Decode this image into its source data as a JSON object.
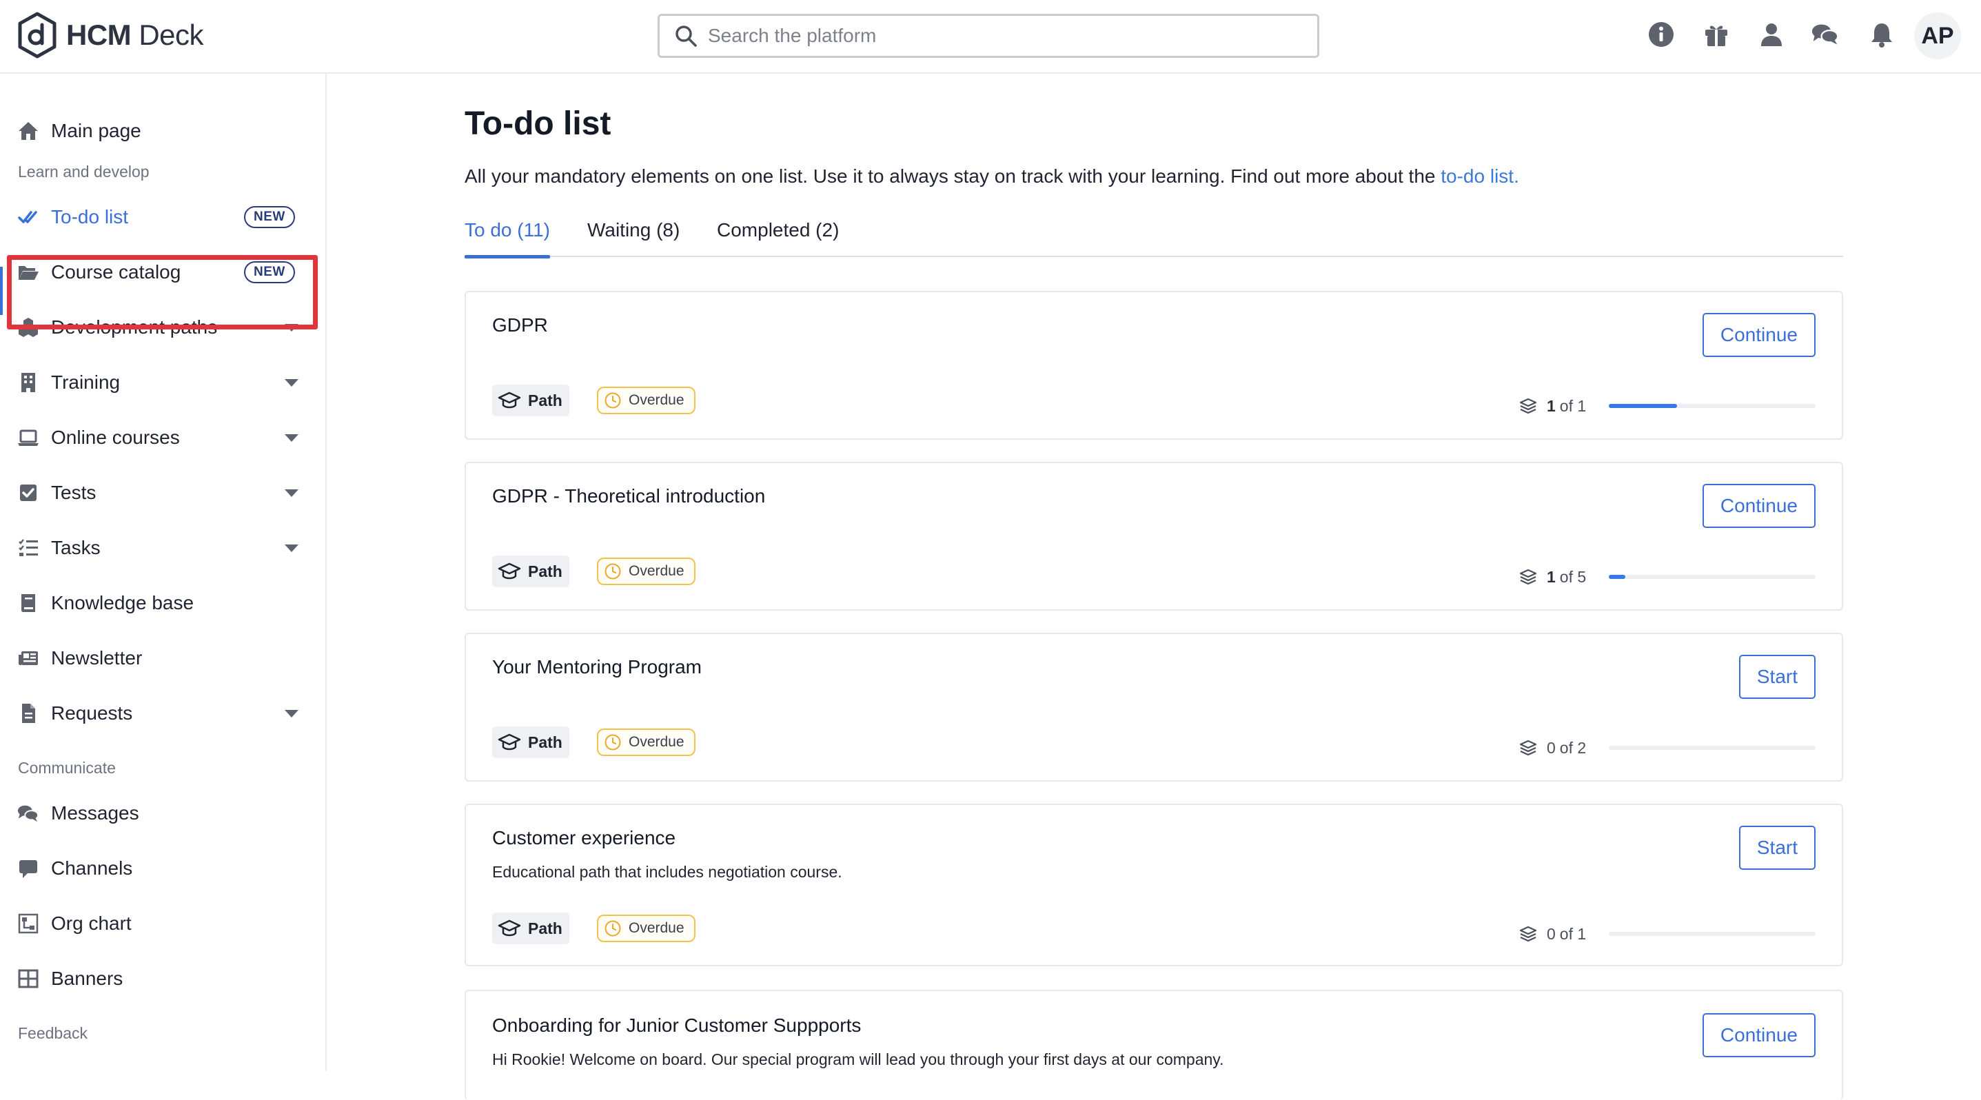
{
  "app": {
    "brand_bold": "HCM",
    "brand_light": "Deck",
    "search_placeholder": "Search the platform",
    "avatar_initials": "AP",
    "header_icons": [
      "info-icon",
      "gift-icon",
      "user-icon",
      "chat-icon",
      "bell-icon"
    ]
  },
  "sidebar": {
    "main_page": "Main page",
    "sections": {
      "learn": "Learn and develop",
      "communicate": "Communicate",
      "feedback": "Feedback"
    },
    "items": [
      {
        "label": "To-do list",
        "icon": "double-check-icon",
        "badge": "NEW",
        "active": true
      },
      {
        "label": "Course catalog",
        "icon": "folder-open-icon",
        "badge": "NEW"
      },
      {
        "label": "Development paths",
        "icon": "cubes-icon",
        "expandable": true
      },
      {
        "label": "Training",
        "icon": "building-icon",
        "expandable": true
      },
      {
        "label": "Online courses",
        "icon": "laptop-icon",
        "expandable": true
      },
      {
        "label": "Tests",
        "icon": "check-square-icon",
        "expandable": true
      },
      {
        "label": "Tasks",
        "icon": "tasks-icon",
        "expandable": true
      },
      {
        "label": "Knowledge base",
        "icon": "book-icon"
      },
      {
        "label": "Newsletter",
        "icon": "newspaper-icon"
      },
      {
        "label": "Requests",
        "icon": "file-icon",
        "expandable": true
      },
      {
        "label": "Messages",
        "icon": "comments-icon"
      },
      {
        "label": "Channels",
        "icon": "comment-icon"
      },
      {
        "label": "Org chart",
        "icon": "sitemap-icon"
      },
      {
        "label": "Banners",
        "icon": "table-icon"
      }
    ]
  },
  "main": {
    "title": "To-do list",
    "intro_text": "All your mandatory elements on one list. Use it to always stay on track with your learning. Find out more about the ",
    "intro_link": "to-do list.",
    "tabs": [
      {
        "label": "To do (11)",
        "active": true
      },
      {
        "label": "Waiting (8)"
      },
      {
        "label": "Completed (2)"
      }
    ],
    "cards": [
      {
        "title": "GDPR",
        "description": "",
        "button": "Continue",
        "type_tag": "Path",
        "status_tag": "Overdue",
        "done": "1",
        "total_text": "of 1",
        "progress": 0.33
      },
      {
        "title": "GDPR - Theoretical introduction",
        "description": "",
        "button": "Continue",
        "type_tag": "Path",
        "status_tag": "Overdue",
        "done": "1",
        "total_text": "of 5",
        "progress": 0.08
      },
      {
        "title": "Your Mentoring Program",
        "description": "",
        "button": "Start",
        "type_tag": "Path",
        "status_tag": "Overdue",
        "done": "0",
        "total_text": "of 2",
        "progress": 0
      },
      {
        "title": "Customer experience",
        "description": "Educational path that includes negotiation course.",
        "button": "Start",
        "type_tag": "Path",
        "status_tag": "Overdue",
        "done": "0",
        "total_text": "of 1",
        "progress": 0
      },
      {
        "title": "Onboarding for Junior Customer Suppports",
        "description": "Hi Rookie! Welcome on board. Our special program will lead you through your first days at our company.",
        "button": "Continue"
      }
    ]
  },
  "colors": {
    "accent": "#3b6fd8",
    "highlight": "#e0353d",
    "overdue": "#f3c24c"
  }
}
